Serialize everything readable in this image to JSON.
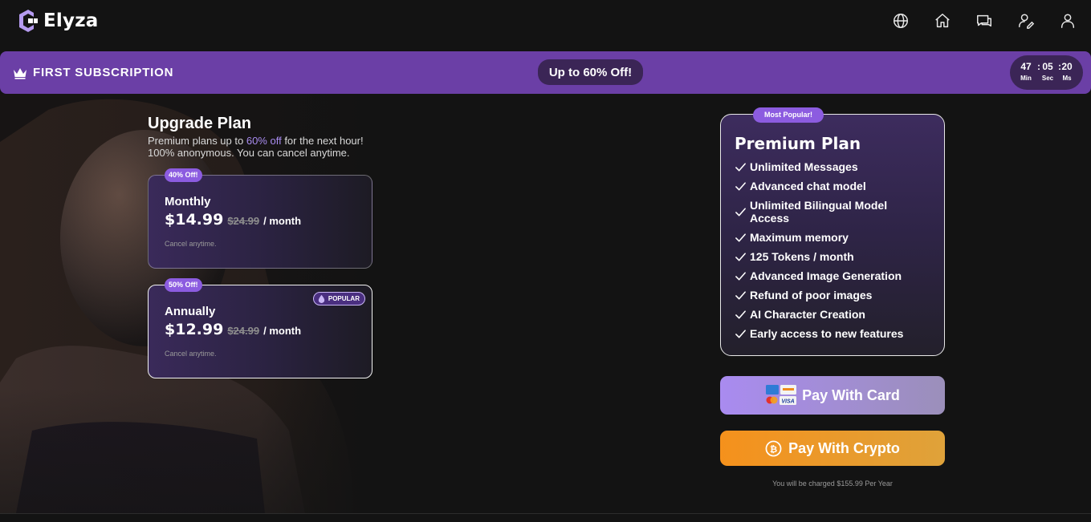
{
  "brand": {
    "name": "Elyza"
  },
  "nav": {
    "icons": [
      "globe-icon",
      "home-icon",
      "chat-icon",
      "edit-profile-icon",
      "user-icon"
    ]
  },
  "promo": {
    "title": "FIRST SUBSCRIPTION",
    "pill": "Up to 60% Off!",
    "timer": {
      "min": "47",
      "sec": "05",
      "ms": "20",
      "min_label": "Min",
      "sec_label": "Sec",
      "ms_label": "Ms",
      "sep": ":"
    }
  },
  "upgrade": {
    "title": "Upgrade Plan",
    "sub_line1_a": "Premium plans up to ",
    "sub_line1_accent": "60% off",
    "sub_line1_b": " for the next hour!",
    "sub_line2": "100% anonymous. You can cancel anytime.",
    "plans": [
      {
        "badge": "40% Off!",
        "name": "Monthly",
        "price": "$14.99",
        "old_price": "$24.99",
        "per": "/ month",
        "cancel": "Cancel anytime."
      },
      {
        "badge": "50% Off!",
        "name": "Annually",
        "price": "$12.99",
        "old_price": "$24.99",
        "per": "/ month",
        "cancel": "Cancel anytime.",
        "popular": "POPULAR"
      }
    ]
  },
  "premium": {
    "badge": "Most Popular!",
    "title": "Premium Plan",
    "features": [
      "Unlimited Messages",
      "Advanced chat model",
      "Unlimited Bilingual Model Access",
      "Maximum memory",
      "125 Tokens / month",
      "Advanced Image Generation",
      "Refund of poor images",
      "AI Character Creation",
      "Early access to new features"
    ]
  },
  "payment": {
    "card_label": "Pay With Card",
    "crypto_label": "Pay With Crypto",
    "charged_note": "You will be charged $155.99 Per Year"
  },
  "colors": {
    "accent": "#8c5ce0",
    "promo_bar": "#6b3fa6",
    "crypto": "#f5911c",
    "background": "#131313"
  }
}
